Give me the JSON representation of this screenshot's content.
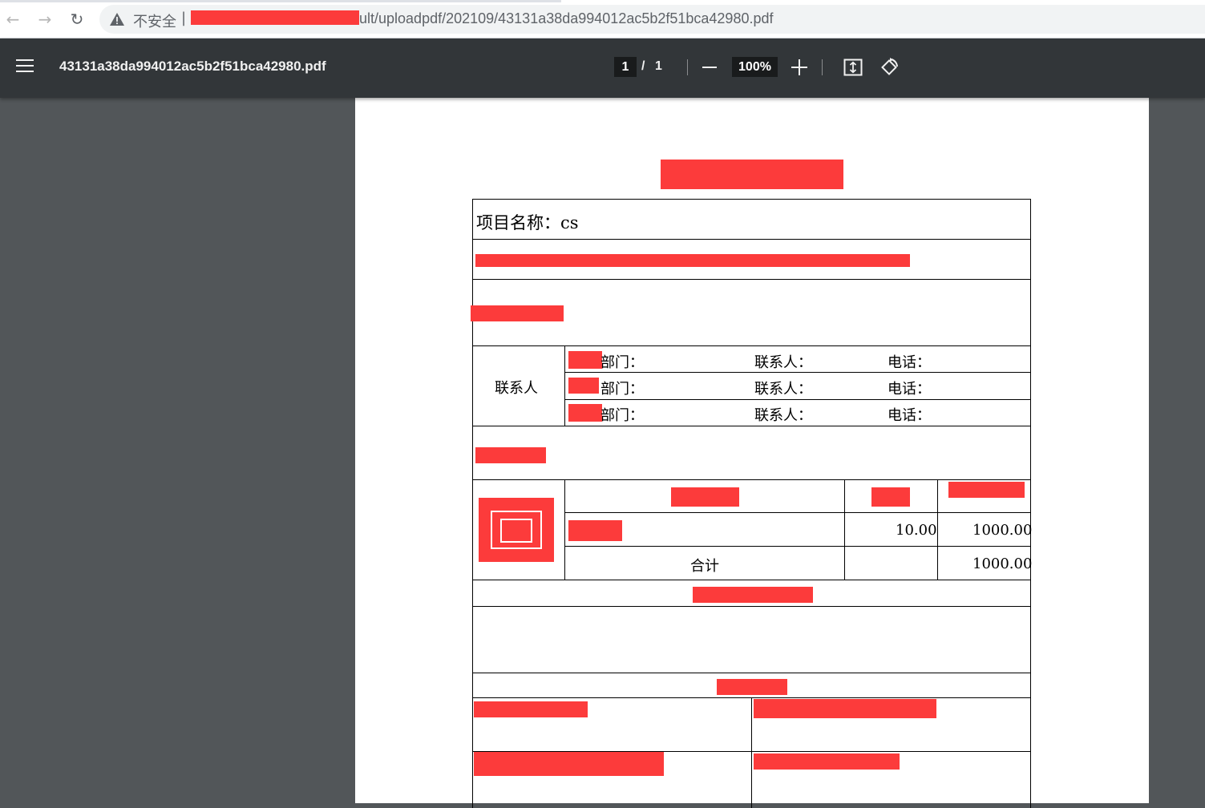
{
  "browser": {
    "insecure_label": "不安全",
    "separator": "|",
    "url_visible": "ult/uploadpdf/202109/43131a38da994012ac5b2f51bca42980.pdf"
  },
  "toolbar": {
    "title": "43131a38da994012ac5b2f51bca42980.pdf",
    "page_current": "1",
    "page_slash": "/",
    "page_total": "1",
    "zoom": "100%",
    "icons": [
      "menu-icon",
      "zoom-out-icon",
      "zoom-in-icon",
      "fit-page-icon",
      "rotate-icon"
    ]
  },
  "document": {
    "project_name_label": "项目名称：cs",
    "contacts": {
      "group_label": "联系人",
      "rows": [
        {
          "dept": "部门：",
          "person": "联系人：",
          "phone": "电话："
        },
        {
          "dept": "部门：",
          "person": "联系人：",
          "phone": "电话："
        },
        {
          "dept": "部门：",
          "person": "联系人：",
          "phone": "电话："
        }
      ]
    },
    "items": {
      "row": {
        "unit_price": "10.00",
        "amount": "1000.00"
      },
      "total_label": "合计",
      "total_amount": "1000.00"
    }
  },
  "colors": {
    "redaction": "#fc3b3b",
    "toolbar_bg": "#323639",
    "viewer_bg": "#525659"
  }
}
